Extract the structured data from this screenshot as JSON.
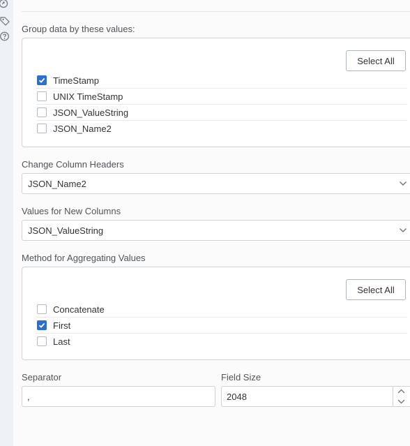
{
  "group_by": {
    "label": "Group data by these values:",
    "select_all_label": "Select All",
    "items": [
      {
        "label": "TimeStamp",
        "checked": true
      },
      {
        "label": "UNIX TimeStamp",
        "checked": false
      },
      {
        "label": "JSON_ValueString",
        "checked": false
      },
      {
        "label": "JSON_Name2",
        "checked": false
      }
    ]
  },
  "change_headers": {
    "label": "Change Column Headers",
    "value": "JSON_Name2"
  },
  "new_values": {
    "label": "Values for New Columns",
    "value": "JSON_ValueString"
  },
  "aggregation": {
    "label": "Method for Aggregating Values",
    "select_all_label": "Select All",
    "items": [
      {
        "label": "Concatenate",
        "checked": false
      },
      {
        "label": "First",
        "checked": true
      },
      {
        "label": "Last",
        "checked": false
      }
    ]
  },
  "separator": {
    "label": "Separator",
    "value": ","
  },
  "field_size": {
    "label": "Field Size",
    "value": "2048"
  },
  "colors": {
    "accent": "#2b6fd0",
    "rail": "#eef1f5"
  }
}
